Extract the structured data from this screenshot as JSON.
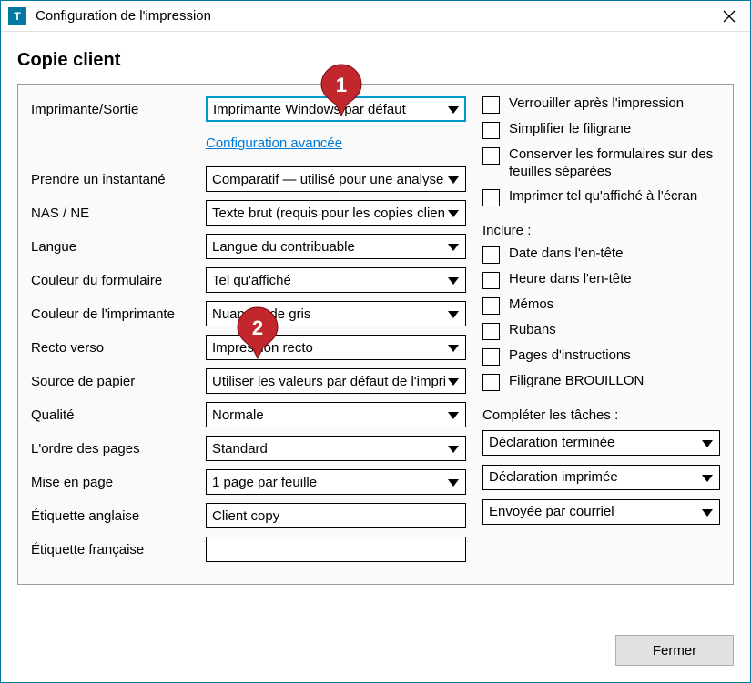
{
  "window": {
    "title": "Configuration de l'impression",
    "heading": "Copie client",
    "close_btn": "Fermer"
  },
  "fields": {
    "printer": {
      "label": "Imprimante/Sortie",
      "value": "Imprimante Windows par défaut"
    },
    "adv_link": "Configuration avancée",
    "snapshot": {
      "label": "Prendre un instantané",
      "value": "Comparatif — utilisé pour une analyse"
    },
    "nas": {
      "label": "NAS / NE",
      "value": "Texte brut (requis pour les copies client)"
    },
    "language": {
      "label": "Langue",
      "value": "Langue du contribuable"
    },
    "form_color": {
      "label": "Couleur du formulaire",
      "value": "Tel qu'affiché"
    },
    "printer_color": {
      "label": "Couleur de l'imprimante",
      "value": "Nuances de gris"
    },
    "duplex": {
      "label": "Recto verso",
      "value": "Impression recto"
    },
    "paper_src": {
      "label": "Source de papier",
      "value": "Utiliser les valeurs par défaut de l'imprimante"
    },
    "quality": {
      "label": "Qualité",
      "value": "Normale"
    },
    "page_order": {
      "label": "L'ordre des pages",
      "value": "Standard"
    },
    "layout": {
      "label": "Mise en page",
      "value": "1 page par feuille"
    },
    "label_en": {
      "label": "Étiquette anglaise",
      "value": "Client copy"
    },
    "label_fr": {
      "label": "Étiquette française",
      "value": ""
    }
  },
  "checks": {
    "lock": "Verrouiller après l'impression",
    "simplify": "Simplifier le filigrane",
    "separate": "Conserver les formulaires sur des feuilles séparées",
    "as_shown": "Imprimer tel qu'affiché à l'écran",
    "include_title": "Inclure :",
    "date": "Date dans l'en-tête",
    "time": "Heure dans l'en-tête",
    "memos": "Mémos",
    "ribbons": "Rubans",
    "instructions": "Pages d'instructions",
    "draft": "Filigrane BROUILLON"
  },
  "tasks": {
    "title": "Compléter les tâches :",
    "t1": "Déclaration terminée",
    "t2": "Déclaration imprimée",
    "t3": "Envoyée par courriel"
  },
  "callouts": {
    "c1": "1",
    "c2": "2"
  }
}
